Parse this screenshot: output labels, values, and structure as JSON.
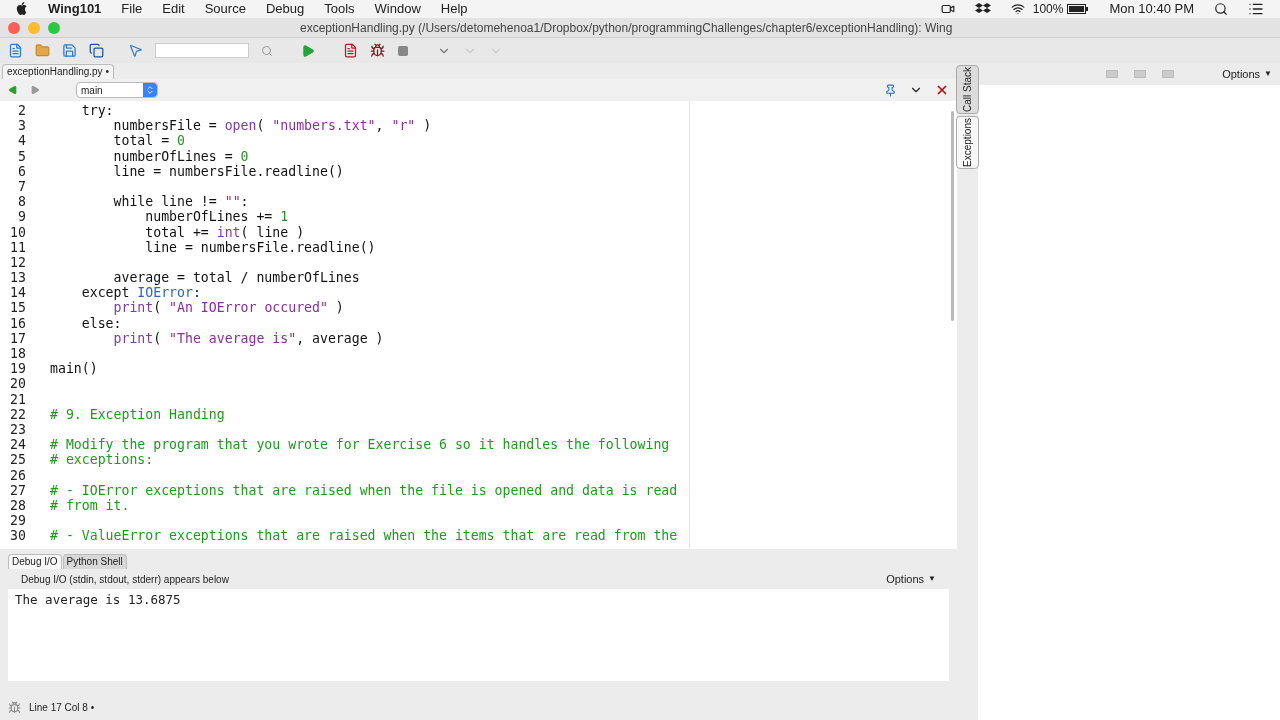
{
  "menubar": {
    "app": "Wing101",
    "items": [
      "File",
      "Edit",
      "Source",
      "Debug",
      "Tools",
      "Window",
      "Help"
    ],
    "battery": "100%",
    "clock": "Mon 10:40 PM"
  },
  "window": {
    "title": "exceptionHandling.py (/Users/detomehenoa1/Dropbox/python/programmingChallenges/chapter6/exceptionHandling): Wing"
  },
  "file_tab": {
    "label": "exceptionHandling.py",
    "modified_mark": "•"
  },
  "scope": {
    "value": "main"
  },
  "code": [
    {
      "num": "2",
      "tokens": [
        {
          "kind": "kw",
          "text": "    try:"
        }
      ]
    },
    {
      "num": "3",
      "tokens": [
        {
          "kind": "plain",
          "text": "        numbersFile = "
        },
        {
          "kind": "builtin",
          "text": "open"
        },
        {
          "kind": "plain",
          "text": "( "
        },
        {
          "kind": "str",
          "text": "\"numbers.txt\""
        },
        {
          "kind": "plain",
          "text": ", "
        },
        {
          "kind": "str",
          "text": "\"r\""
        },
        {
          "kind": "plain",
          "text": " )"
        }
      ]
    },
    {
      "num": "4",
      "tokens": [
        {
          "kind": "plain",
          "text": "        total = "
        },
        {
          "kind": "num",
          "text": "0"
        }
      ]
    },
    {
      "num": "5",
      "tokens": [
        {
          "kind": "plain",
          "text": "        numberOfLines = "
        },
        {
          "kind": "num",
          "text": "0"
        }
      ]
    },
    {
      "num": "6",
      "tokens": [
        {
          "kind": "plain",
          "text": "        line = numbersFile.readline()"
        }
      ]
    },
    {
      "num": "7"
    },
    {
      "num": "8",
      "tokens": [
        {
          "kind": "kw",
          "text": "        while"
        },
        {
          "kind": "plain",
          "text": " line != "
        },
        {
          "kind": "str",
          "text": "\"\""
        },
        {
          "kind": "plain",
          "text": ":"
        }
      ]
    },
    {
      "num": "9",
      "tokens": [
        {
          "kind": "plain",
          "text": "            numberOfLines += "
        },
        {
          "kind": "num",
          "text": "1"
        }
      ]
    },
    {
      "num": "10",
      "tokens": [
        {
          "kind": "plain",
          "text": "            total += "
        },
        {
          "kind": "builtin",
          "text": "int"
        },
        {
          "kind": "plain",
          "text": "( line )"
        }
      ]
    },
    {
      "num": "11",
      "tokens": [
        {
          "kind": "plain",
          "text": "            line = numbersFile.readline()"
        }
      ]
    },
    {
      "num": "12"
    },
    {
      "num": "13",
      "tokens": [
        {
          "kind": "plain",
          "text": "        average = total / numberOfLines"
        }
      ]
    },
    {
      "num": "14",
      "tokens": [
        {
          "kind": "kw",
          "text": "    except "
        },
        {
          "kind": "class",
          "text": "IOError"
        },
        {
          "kind": "plain",
          "text": ":"
        }
      ]
    },
    {
      "num": "15",
      "tokens": [
        {
          "kind": "builtin",
          "text": "        print"
        },
        {
          "kind": "plain",
          "text": "( "
        },
        {
          "kind": "str",
          "text": "\"An IOError occured\""
        },
        {
          "kind": "plain",
          "text": " )"
        }
      ]
    },
    {
      "num": "16",
      "tokens": [
        {
          "kind": "kw",
          "text": "    else:"
        }
      ]
    },
    {
      "num": "17",
      "tokens": [
        {
          "kind": "builtin",
          "text": "        print"
        },
        {
          "kind": "plain",
          "text": "( "
        },
        {
          "kind": "str",
          "text": "\"The average is\""
        },
        {
          "kind": "plain",
          "text": ", average )"
        }
      ]
    },
    {
      "num": "18"
    },
    {
      "num": "19",
      "tokens": [
        {
          "kind": "plain",
          "text": "main()"
        }
      ]
    },
    {
      "num": "20"
    },
    {
      "num": "21"
    },
    {
      "num": "22",
      "tokens": [
        {
          "kind": "comment",
          "text": "# 9. Exception Handing"
        }
      ]
    },
    {
      "num": "23"
    },
    {
      "num": "24",
      "tokens": [
        {
          "kind": "comment",
          "text": "# Modify the program that you wrote for Exercise 6 so it handles the following"
        }
      ]
    },
    {
      "num": "25",
      "tokens": [
        {
          "kind": "comment",
          "text": "# exceptions:"
        }
      ]
    },
    {
      "num": "26"
    },
    {
      "num": "27",
      "tokens": [
        {
          "kind": "comment",
          "text": "# - IOError exceptions that are raised when the file is opened and data is read"
        }
      ]
    },
    {
      "num": "28",
      "tokens": [
        {
          "kind": "comment",
          "text": "# from it."
        }
      ]
    },
    {
      "num": "29"
    },
    {
      "num": "30",
      "tokens": [
        {
          "kind": "comment",
          "text": "# - ValueError exceptions that are raised when the items that are read from the"
        }
      ]
    }
  ],
  "side_tabs": [
    {
      "label": "Call Stack",
      "selected": false
    },
    {
      "label": "Exceptions",
      "selected": true
    }
  ],
  "right_panel": {
    "options": "Options",
    "options_arrow": "▼"
  },
  "bottom_tabs": [
    {
      "label": "Debug I/O",
      "selected": true
    },
    {
      "label": "Python Shell",
      "selected": false
    }
  ],
  "debug_io": {
    "hint": "Debug I/O (stdin, stdout, stderr) appears below",
    "options": "Options",
    "options_arrow": "▼",
    "output": "The average is 13.6875"
  },
  "status_bar": {
    "position": "Line 17 Col 8",
    "modified_mark": "•"
  }
}
